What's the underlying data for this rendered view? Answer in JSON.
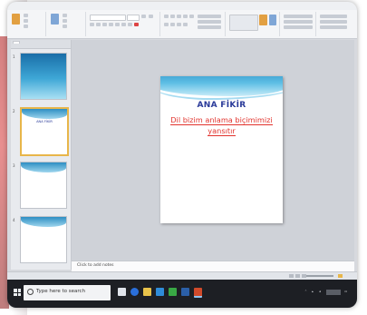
{
  "ribbon": {
    "tabs": [
      "",
      "",
      "",
      "",
      "",
      "",
      "",
      ""
    ],
    "groups": [
      "",
      "",
      "",
      "",
      "",
      "",
      "",
      ""
    ]
  },
  "left_pane": {
    "tab_slides": "",
    "tab_outline": ""
  },
  "slides": [
    {
      "num": "1",
      "title": "",
      "body": ""
    },
    {
      "num": "2",
      "title": "ANA FİKİR",
      "body": ""
    },
    {
      "num": "3",
      "title": "",
      "body": ""
    },
    {
      "num": "4",
      "title": "",
      "body": ""
    }
  ],
  "current_slide": {
    "title": "ANA FİKİR",
    "body_line1": "Dil bizim anlama biçimimizi",
    "body_line2": "yansıtır"
  },
  "notes": {
    "placeholder": "Click to add notes"
  },
  "taskbar": {
    "search_placeholder": "Type here to search"
  },
  "colors": {
    "slide_title": "#2a3a99",
    "slide_body": "#e2342e",
    "wave_dark": "#1c83bd",
    "wave_light": "#8fd3ee",
    "taskbar": "#1d1f24",
    "selected_thumb_border": "#e8b64a"
  }
}
